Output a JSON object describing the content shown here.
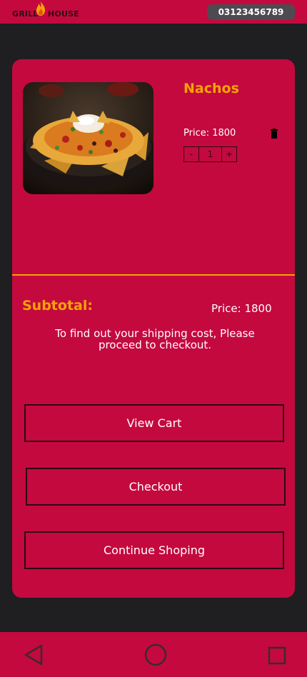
{
  "header": {
    "logo_text_left": "GRILL",
    "logo_text_right": "HOUSE",
    "phone": "03123456789"
  },
  "cart_item": {
    "name": "Nachos",
    "price_label": "Price:",
    "price": "1800",
    "quantity": "1",
    "decrement": "-",
    "increment": "+",
    "image_icon": "nachos-food-photo"
  },
  "summary": {
    "subtotal_label": "Subtotal:",
    "price_label": "Price:",
    "price": "1800",
    "shipping_note": "To find out your shipping cost, Please proceed to checkout."
  },
  "buttons": {
    "view_cart": "View Cart",
    "checkout": "Checkout",
    "continue": "Continue Shoping"
  },
  "nav": {
    "back_icon": "triangle-back-icon",
    "home_icon": "circle-home-icon",
    "recent_icon": "square-recent-icon"
  },
  "colors": {
    "accent": "#c4093f",
    "highlight": "#f5a400",
    "background": "#1f1e21"
  }
}
